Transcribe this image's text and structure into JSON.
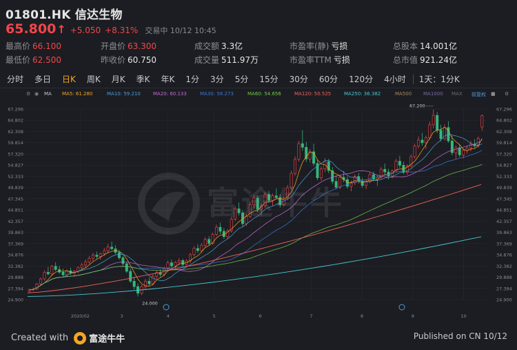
{
  "header": {
    "title": "01801.HK 信达生物",
    "price": "65.800",
    "change": "+5.050",
    "change_pct": "+8.31%",
    "time_label": "交易中 10/12 10:45"
  },
  "stats": [
    {
      "label": "最高价",
      "value": "66.100",
      "color": "red"
    },
    {
      "label": "开盘价",
      "value": "63.300",
      "color": "red"
    },
    {
      "label": "成交额",
      "value": "3.3亿",
      "color": "white"
    },
    {
      "label": "市盈率(静)",
      "value": "亏损",
      "color": "white"
    },
    {
      "label": "总股本",
      "value": "14.001亿",
      "color": "white"
    },
    {
      "label": "最低价",
      "value": "62.500",
      "color": "red"
    },
    {
      "label": "昨收价",
      "value": "60.750",
      "color": "white"
    },
    {
      "label": "成交量",
      "value": "511.97万",
      "color": "white"
    },
    {
      "label": "市盈率TTM",
      "value": "亏损",
      "color": "white"
    },
    {
      "label": "总市值",
      "value": "921.24亿",
      "color": "white"
    }
  ],
  "tabs": [
    "分时",
    "多日",
    "日K",
    "周K",
    "月K",
    "季K",
    "年K",
    "1分",
    "3分",
    "5分",
    "15分",
    "30分",
    "60分",
    "120分",
    "4小时",
    "1天：1分K"
  ],
  "active_tab": "日K",
  "ma_legend": [
    {
      "label": "MA",
      "color": "#c9c9cc"
    },
    {
      "label": "MA5: 61.280",
      "color": "#f5a623"
    },
    {
      "label": "MA10: 59.210",
      "color": "#4f9dd9"
    },
    {
      "label": "MA20: 60.133",
      "color": "#c46bd8"
    },
    {
      "label": "MA30: 58.273",
      "color": "#3a78d8"
    },
    {
      "label": "MA60: 54.656",
      "color": "#74c94b"
    },
    {
      "label": "MA120: 50.525",
      "color": "#f0645a"
    },
    {
      "label": "MA250: 36.382",
      "color": "#47c9d8"
    },
    {
      "label": "MA500",
      "color": "#a68a5b"
    },
    {
      "label": "MA1000",
      "color": "#7a6aa0"
    },
    {
      "label": "MAX",
      "color": "#6b6b70"
    },
    {
      "label": "前复权",
      "color": "#4f9dd9"
    }
  ],
  "chart_data": {
    "type": "candlestick",
    "y_ticks": [
      "67.296",
      "64.802",
      "62.308",
      "59.814",
      "57.320",
      "54.827",
      "52.333",
      "49.839",
      "47.345",
      "44.851",
      "42.357",
      "39.863",
      "37.369",
      "34.876",
      "32.382",
      "29.888",
      "27.394",
      "24.900"
    ],
    "y_range": [
      24.9,
      67.296
    ],
    "x_labels": [
      "2020/02",
      "3",
      "4",
      "5",
      "6",
      "7",
      "8",
      "9",
      "10"
    ],
    "annotation_high": "67.200",
    "annotation_low": "24.000",
    "candles": [
      [
        26.8,
        27.3,
        26.4,
        27.1
      ],
      [
        27.1,
        27.6,
        26.8,
        27.2
      ],
      [
        27.3,
        28.6,
        27.0,
        28.4
      ],
      [
        28.4,
        29.8,
        28.0,
        29.5
      ],
      [
        29.5,
        31.4,
        29.1,
        31.0
      ],
      [
        31.0,
        32.2,
        30.3,
        30.6
      ],
      [
        30.6,
        32.6,
        30.2,
        32.3
      ],
      [
        32.3,
        33.2,
        31.2,
        31.6
      ],
      [
        31.6,
        32.4,
        30.6,
        31.0
      ],
      [
        31.0,
        31.8,
        30.0,
        30.4
      ],
      [
        30.4,
        31.6,
        30.0,
        31.3
      ],
      [
        31.3,
        32.0,
        30.4,
        30.8
      ],
      [
        30.8,
        31.5,
        30.0,
        31.2
      ],
      [
        31.2,
        32.3,
        30.8,
        32.0
      ],
      [
        32.0,
        33.1,
        31.5,
        32.6
      ],
      [
        32.6,
        33.8,
        32.0,
        33.3
      ],
      [
        33.3,
        34.6,
        32.8,
        34.1
      ],
      [
        34.1,
        35.3,
        33.5,
        34.8
      ],
      [
        34.8,
        35.6,
        34.0,
        34.5
      ],
      [
        34.5,
        35.4,
        33.8,
        35.1
      ],
      [
        35.1,
        36.4,
        34.6,
        35.8
      ],
      [
        35.8,
        37.3,
        35.2,
        36.6
      ],
      [
        36.6,
        37.8,
        35.9,
        36.2
      ],
      [
        36.2,
        37.0,
        35.0,
        35.4
      ],
      [
        35.4,
        35.9,
        33.8,
        34.2
      ],
      [
        34.2,
        34.7,
        32.5,
        32.9
      ],
      [
        32.9,
        33.3,
        30.8,
        31.2
      ],
      [
        31.2,
        31.8,
        28.6,
        29.0
      ],
      [
        29.0,
        30.0,
        27.2,
        27.8
      ],
      [
        27.8,
        28.5,
        25.6,
        26.3
      ],
      [
        26.3,
        28.2,
        25.9,
        27.8
      ],
      [
        27.8,
        29.5,
        27.2,
        29.0
      ],
      [
        29.0,
        29.8,
        28.0,
        28.4
      ],
      [
        28.4,
        30.5,
        28.0,
        30.1
      ],
      [
        30.1,
        31.4,
        29.5,
        30.9
      ],
      [
        30.9,
        31.6,
        30.0,
        30.5
      ],
      [
        30.5,
        32.2,
        30.1,
        31.8
      ],
      [
        31.8,
        33.6,
        31.4,
        33.1
      ],
      [
        33.1,
        33.8,
        32.0,
        32.4
      ],
      [
        32.4,
        33.5,
        31.8,
        33.2
      ],
      [
        33.2,
        34.1,
        32.6,
        33.6
      ],
      [
        33.6,
        34.0,
        32.2,
        32.7
      ],
      [
        32.7,
        33.9,
        32.3,
        33.5
      ],
      [
        33.5,
        35.3,
        33.0,
        34.9
      ],
      [
        34.9,
        36.8,
        34.5,
        36.3
      ],
      [
        36.3,
        37.2,
        35.3,
        35.8
      ],
      [
        35.8,
        37.5,
        35.4,
        37.0
      ],
      [
        37.0,
        38.8,
        36.5,
        38.3
      ],
      [
        38.3,
        39.0,
        36.9,
        37.4
      ],
      [
        37.4,
        39.8,
        37.1,
        39.4
      ],
      [
        39.4,
        41.6,
        39.0,
        41.0
      ],
      [
        41.0,
        42.0,
        39.5,
        40.1
      ],
      [
        40.1,
        40.8,
        38.4,
        38.9
      ],
      [
        38.9,
        40.6,
        38.5,
        40.2
      ],
      [
        40.2,
        43.3,
        39.8,
        42.8
      ],
      [
        42.8,
        45.6,
        42.4,
        45.1
      ],
      [
        45.1,
        46.5,
        43.6,
        44.2
      ],
      [
        44.2,
        44.8,
        41.2,
        41.8
      ],
      [
        41.8,
        43.9,
        41.3,
        43.4
      ],
      [
        43.4,
        46.6,
        43.0,
        46.0
      ],
      [
        46.0,
        48.2,
        45.2,
        47.5
      ],
      [
        47.5,
        48.0,
        44.4,
        45.0
      ],
      [
        45.0,
        46.3,
        43.6,
        45.8
      ],
      [
        45.8,
        48.8,
        45.3,
        48.3
      ],
      [
        48.3,
        49.1,
        46.5,
        47.0
      ],
      [
        47.0,
        48.5,
        45.8,
        48.0
      ],
      [
        48.0,
        49.6,
        47.2,
        47.6
      ],
      [
        47.6,
        48.4,
        45.4,
        46.0
      ],
      [
        46.0,
        48.0,
        45.6,
        47.5
      ],
      [
        47.5,
        50.4,
        47.0,
        49.8
      ],
      [
        49.8,
        53.6,
        49.4,
        53.0
      ],
      [
        53.0,
        56.8,
        52.5,
        56.1
      ],
      [
        56.1,
        60.2,
        55.6,
        59.6
      ],
      [
        59.6,
        62.6,
        58.0,
        58.8
      ],
      [
        58.8,
        60.0,
        55.5,
        56.2
      ],
      [
        56.2,
        58.4,
        55.4,
        57.8
      ],
      [
        57.8,
        59.6,
        54.6,
        55.2
      ],
      [
        55.2,
        56.0,
        51.5,
        52.0
      ],
      [
        52.0,
        54.5,
        51.4,
        54.0
      ],
      [
        54.0,
        56.4,
        53.3,
        55.6
      ],
      [
        55.6,
        56.2,
        53.0,
        53.6
      ],
      [
        53.6,
        54.4,
        50.6,
        51.2
      ],
      [
        51.2,
        52.5,
        49.4,
        49.9
      ],
      [
        49.9,
        52.6,
        49.5,
        52.1
      ],
      [
        52.1,
        53.5,
        51.0,
        51.6
      ],
      [
        51.6,
        52.3,
        49.6,
        50.1
      ],
      [
        50.1,
        51.4,
        49.0,
        50.9
      ],
      [
        50.9,
        52.8,
        50.4,
        52.3
      ],
      [
        52.3,
        53.1,
        50.7,
        51.2
      ],
      [
        51.2,
        52.0,
        49.8,
        50.3
      ],
      [
        50.3,
        51.6,
        49.5,
        51.1
      ],
      [
        51.1,
        53.2,
        50.8,
        52.7
      ],
      [
        52.7,
        53.4,
        51.2,
        51.7
      ],
      [
        51.7,
        52.5,
        50.2,
        52.1
      ],
      [
        52.1,
        54.4,
        51.7,
        53.9
      ],
      [
        53.9,
        55.2,
        52.8,
        53.3
      ],
      [
        53.3,
        54.0,
        51.6,
        52.4
      ],
      [
        52.4,
        53.8,
        51.9,
        53.6
      ],
      [
        53.6,
        56.2,
        53.2,
        55.7
      ],
      [
        55.7,
        56.9,
        54.2,
        54.8
      ],
      [
        54.8,
        55.6,
        52.8,
        53.2
      ],
      [
        53.2,
        55.0,
        52.7,
        54.6
      ],
      [
        54.6,
        57.2,
        54.3,
        56.7
      ],
      [
        56.7,
        59.6,
        56.2,
        59.1
      ],
      [
        59.1,
        61.2,
        58.5,
        60.4
      ],
      [
        60.4,
        62.0,
        59.2,
        59.8
      ],
      [
        59.8,
        61.4,
        58.4,
        60.9
      ],
      [
        60.9,
        64.5,
        60.5,
        63.8
      ],
      [
        63.8,
        67.2,
        63.0,
        65.9
      ],
      [
        65.9,
        66.6,
        62.0,
        62.6
      ],
      [
        62.6,
        63.8,
        60.1,
        60.7
      ],
      [
        60.7,
        63.9,
        60.3,
        63.2
      ],
      [
        63.2,
        64.6,
        59.8,
        60.2
      ],
      [
        60.2,
        61.3,
        57.0,
        57.6
      ],
      [
        57.6,
        59.2,
        56.2,
        58.7
      ],
      [
        58.7,
        59.5,
        56.6,
        57.1
      ],
      [
        57.1,
        58.5,
        56.3,
        58.1
      ],
      [
        58.1,
        59.2,
        57.4,
        58.6
      ],
      [
        58.6,
        60.2,
        57.9,
        59.5
      ],
      [
        59.5,
        60.6,
        58.6,
        59.1
      ],
      [
        59.1,
        61.2,
        58.7,
        60.75
      ],
      [
        63.3,
        66.1,
        62.5,
        65.8
      ]
    ]
  },
  "footer": {
    "created_with": "Created with",
    "brand": "富途牛牛",
    "published": "Published on CN 10/12"
  }
}
